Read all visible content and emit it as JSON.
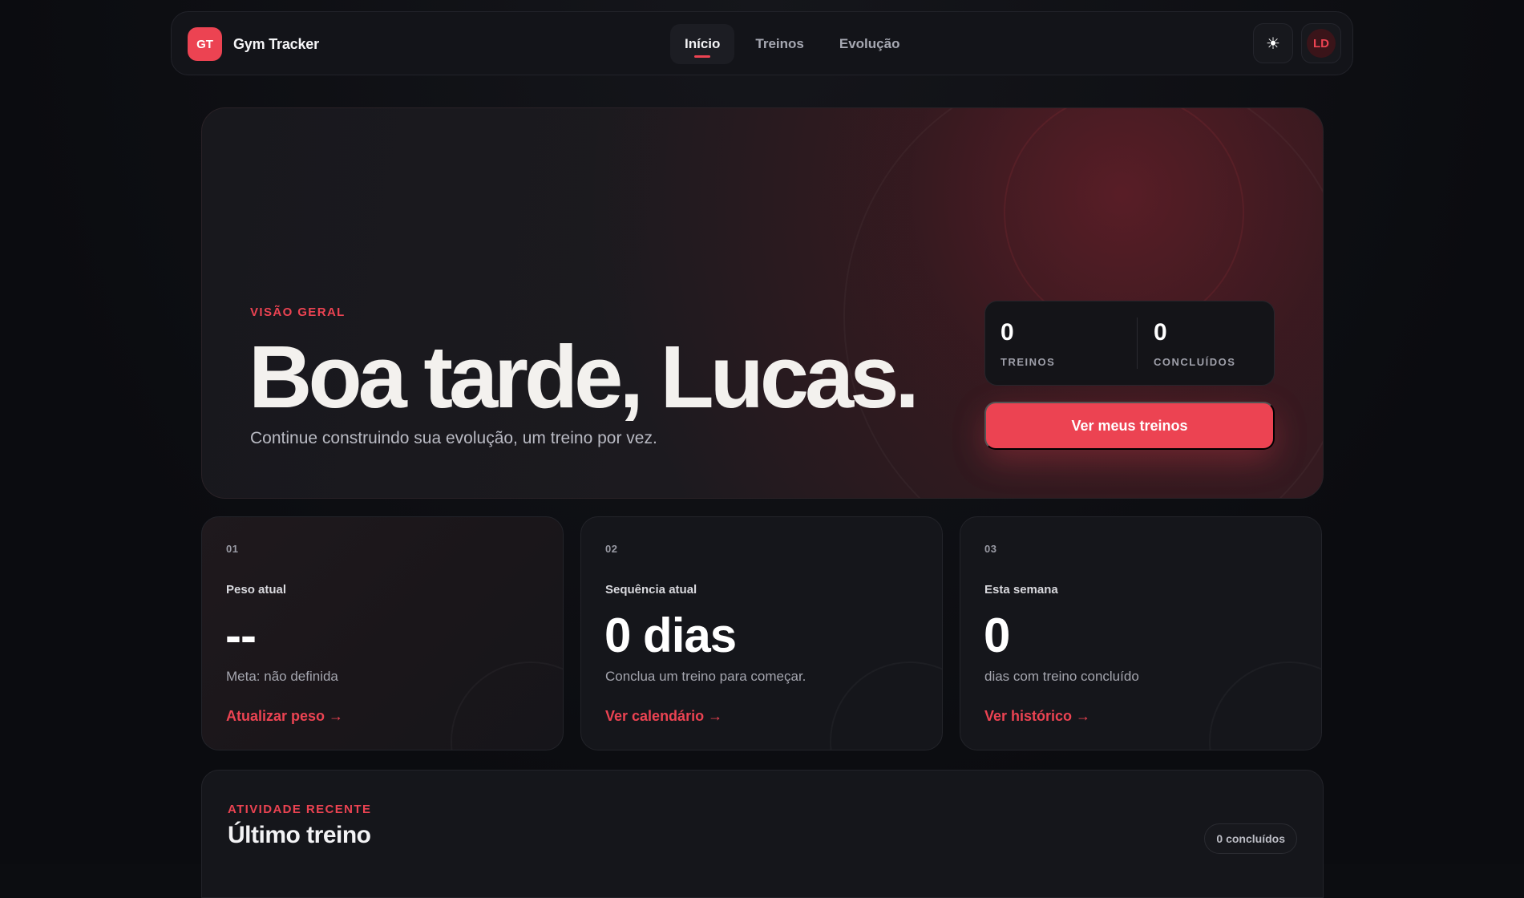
{
  "brand": {
    "logo_text": "GT",
    "name": "Gym Tracker"
  },
  "nav": {
    "items": [
      {
        "label": "Início",
        "active": true
      },
      {
        "label": "Treinos",
        "active": false
      },
      {
        "label": "Evolução",
        "active": false
      }
    ]
  },
  "header_actions": {
    "theme_icon": "sun-icon",
    "theme_glyph": "☀",
    "avatar_initials": "LD"
  },
  "hero": {
    "eyebrow": "VISÃO GERAL",
    "title": "Boa tarde, Lucas.",
    "subtitle": "Continue construindo sua evolução, um treino por vez.",
    "stats": [
      {
        "value": "0",
        "label": "TREINOS"
      },
      {
        "value": "0",
        "label": "CONCLUÍDOS"
      }
    ],
    "cta_label": "Ver meus treinos"
  },
  "cards": [
    {
      "number": "01",
      "label": "Peso atual",
      "value": "--",
      "description": "Meta: não definida",
      "link": "Atualizar peso →"
    },
    {
      "number": "02",
      "label": "Sequência atual",
      "value": "0 dias",
      "description": "Conclua um treino para começar.",
      "link": "Ver calendário →"
    },
    {
      "number": "03",
      "label": "Esta semana",
      "value": "0",
      "description": "dias com treino concluído",
      "link": "Ver histórico →"
    }
  ],
  "recent": {
    "eyebrow": "ATIVIDADE RECENTE",
    "title": "Último treino",
    "badge": "0 concluídos"
  },
  "colors": {
    "accent": "#ec4352",
    "background": "#0c0d11",
    "surface": "#15161b"
  }
}
